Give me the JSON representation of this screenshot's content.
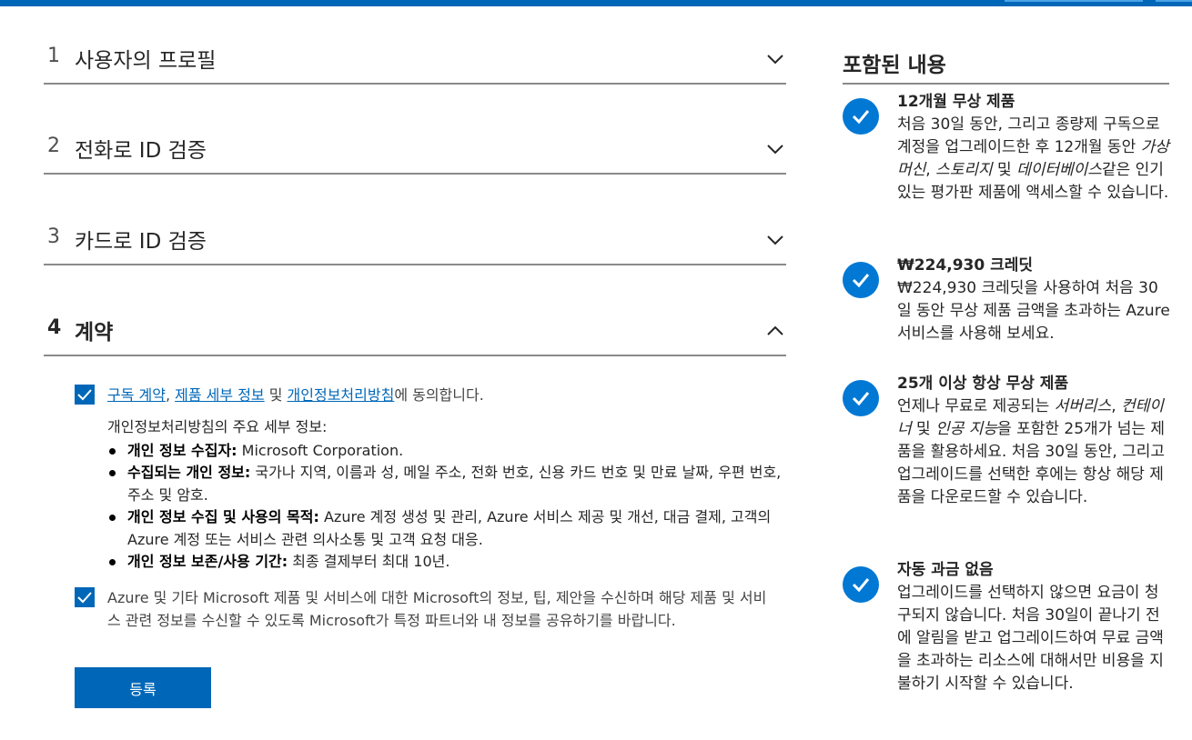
{
  "steps": [
    {
      "num": "1",
      "title": "사용자의 프로필",
      "state": "collapsed"
    },
    {
      "num": "2",
      "title": "전화로 ID 검증",
      "state": "collapsed"
    },
    {
      "num": "3",
      "title": "카드로 ID 검증",
      "state": "collapsed"
    },
    {
      "num": "4",
      "title": "계약",
      "state": "expanded"
    }
  ],
  "agreement": {
    "consent1": {
      "checked": true,
      "link1": "구독 계약",
      "sep1": ", ",
      "link2": "제품 세부 정보",
      "sep2": " 및 ",
      "link3": "개인정보처리방침",
      "suffix": "에 동의합니다."
    },
    "privacy_heading": "개인정보처리방침의 주요 세부 정보:",
    "privacy_items": [
      {
        "label": "개인 정보 수집자:",
        "text": " Microsoft Corporation."
      },
      {
        "label": "수집되는 개인 정보:",
        "text": " 국가나 지역, 이름과 성, 메일 주소, 전화 번호, 신용 카드 번호 및 만료 날짜, 우편 번호, 주소 및 암호."
      },
      {
        "label": "개인 정보 수집 및 사용의 목적:",
        "text": " Azure 계정 생성 및 관리, Azure 서비스 제공 및 개선, 대금 결제, 고객의 Azure 계정 또는 서비스 관련 의사소통 및 고객 요청 대응."
      },
      {
        "label": "개인 정보 보존/사용 기간:",
        "text": " 최종 결제부터 최대 10년."
      }
    ],
    "consent2": {
      "checked": true,
      "text": "Azure 및 기타 Microsoft 제품 및 서비스에 대한 Microsoft의 정보, 팁, 제안을 수신하며 해당 제품 및 서비스 관련 정보를 수신할 수 있도록 Microsoft가 특정 파트너와 내 정보를 공유하기를 바랍니다."
    },
    "submit_label": "등록"
  },
  "included": {
    "heading": "포함된 내용",
    "benefits": [
      {
        "title": "12개월 무상 제품",
        "p1": "처음 30일 동안, 그리고 종량제 구독으로 계정을 업그레이드한 후 12개월 동안 ",
        "i1": "가상 머신",
        "p2": ", ",
        "i2": "스토리지",
        "p3": " 및 ",
        "i3": "데이터베이스",
        "p4": "같은 인기 있는 평가판 제품에 액세스할 수 있습니다."
      },
      {
        "title": "₩224,930 크레딧",
        "p1": "₩224,930 크레딧을 사용하여 처음 30일 동안 무상 제품 금액을 초과하는 Azure 서비스를 사용해 보세요."
      },
      {
        "title": "25개 이상 항상 무상 제품",
        "p1": "언제나 무료로 제공되는 ",
        "i1": "서버리스",
        "p2": ", ",
        "i2": "컨테이너",
        "p3": " 및 ",
        "i3": "인공 지능",
        "p4": "을 포함한 25개가 넘는 제품을 활용하세요. 처음 30일 동안, 그리고 업그레이드를 선택한 후에는 항상 해당 제품을 다운로드할 수 있습니다."
      },
      {
        "title": "자동 과금 없음",
        "p1": "업그레이드를 선택하지 않으면 요금이 청구되지 않습니다. 처음 30일이 끝나기 전에 알림을 받고 업그레이드하여 무료 금액을 초과하는 리소스에 대해서만 비용을 지불하기 시작할 수 있습니다."
      }
    ]
  },
  "colors": {
    "brand": "#0067b8",
    "check_circle": "#0078d4",
    "divider": "#8a8a8a"
  },
  "icons": {
    "collapsed": "chevron-down-icon",
    "expanded": "chevron-up-icon",
    "checkbox": "checkmark-icon",
    "benefit": "check-circle-icon"
  }
}
